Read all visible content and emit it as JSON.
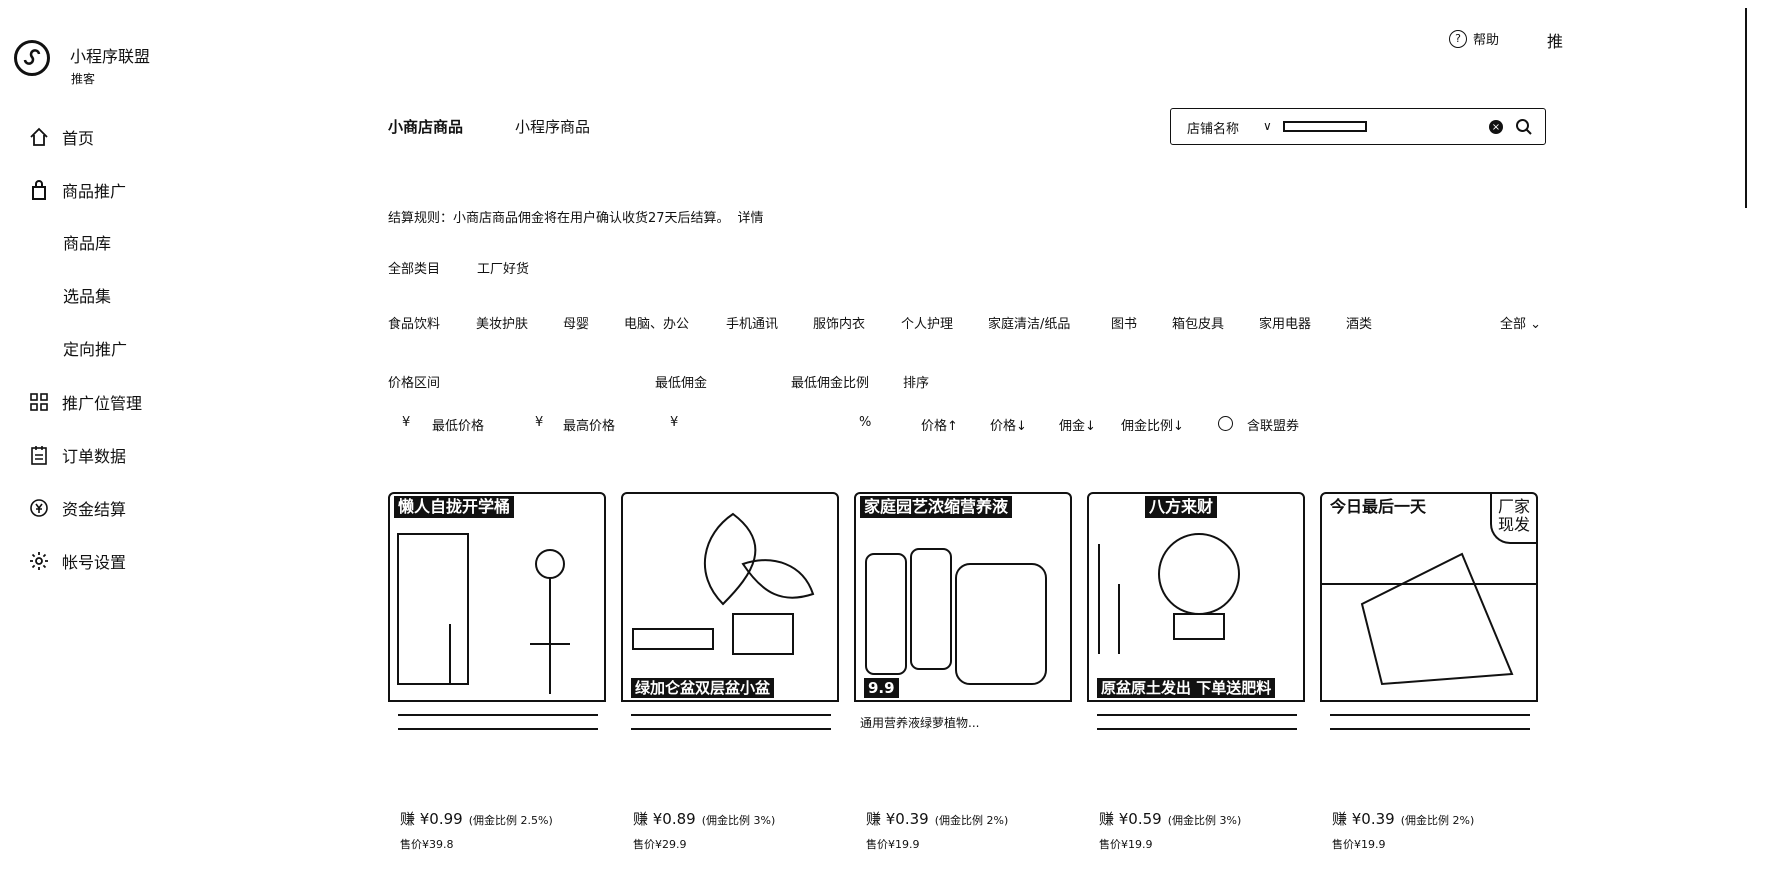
{
  "brand": {
    "title": "小程序联盟",
    "subtitle": "推客"
  },
  "header": {
    "help_label": "帮助",
    "push_label": "推"
  },
  "sidebar": {
    "items": [
      {
        "label": "首页",
        "icon": "home-icon"
      },
      {
        "label": "商品推广",
        "icon": "bag-icon"
      },
      {
        "label": "商品库",
        "sub": true
      },
      {
        "label": "选品集",
        "sub": true
      },
      {
        "label": "定向推广",
        "sub": true
      },
      {
        "label": "推广位管理",
        "icon": "grid-icon"
      },
      {
        "label": "订单数据",
        "icon": "clipboard-icon"
      },
      {
        "label": "资金结算",
        "icon": "yuan-icon"
      },
      {
        "label": "帐号设置",
        "icon": "gear-icon"
      }
    ]
  },
  "tabs": [
    {
      "label": "小商店商品",
      "active": true
    },
    {
      "label": "小程序商品",
      "active": false
    }
  ],
  "search": {
    "select_label": "店铺名称",
    "value": ""
  },
  "rule": {
    "text": "结算规则：小商店商品佣金将在用户确认收货27天后结算。",
    "link": "详情"
  },
  "category_types": [
    "全部类目",
    "工厂好货"
  ],
  "categories": [
    "食品饮料",
    "美妆护肤",
    "母婴",
    "电脑、办公",
    "手机通讯",
    "服饰内衣",
    "个人护理",
    "家庭清洁/纸品",
    "图书",
    "箱包皮具",
    "家用电器",
    "酒类"
  ],
  "categories_all": "全部",
  "filters": {
    "price_range_label": "价格区间",
    "min_commission_label": "最低佣金",
    "min_ratio_label": "最低佣金比例",
    "sort_label": "排序",
    "currency": "¥",
    "min_price_placeholder": "最低价格",
    "max_price_placeholder": "最高价格",
    "percent": "%",
    "sort_options": [
      "价格↑",
      "价格↓",
      "佣金↓",
      "佣金比例↓"
    ],
    "coupon_label": "含联盟券"
  },
  "products": [
    {
      "banner": "懒人自拢开学桶",
      "bottom": "",
      "title": "",
      "earn": "赚 ¥0.99",
      "ratio": "(佣金比例 2.5%)",
      "price": "售价¥39.8"
    },
    {
      "banner": "",
      "bottom": "绿加仑盆双层盆小盆",
      "title": "",
      "earn": "赚 ¥0.89",
      "ratio": "(佣金比例 3%)",
      "price": "售价¥29.9"
    },
    {
      "banner": "家庭园艺浓缩营养液",
      "bottom": "9.9",
      "title": "通用营养液绿萝植物...",
      "earn": "赚 ¥0.39",
      "ratio": "(佣金比例 2%)",
      "price": "售价¥19.9"
    },
    {
      "banner": "八方来财",
      "bottom": "原盆原土发出 下单送肥料",
      "title": "",
      "earn": "赚 ¥0.59",
      "ratio": "(佣金比例 3%)",
      "price": "售价¥19.9"
    },
    {
      "banner": "今日最后一天",
      "bottom": "",
      "title": "",
      "earn": "赚 ¥0.39",
      "ratio": "(佣金比例 2%)",
      "price": "售价¥19.9",
      "tag": "厂家现发"
    }
  ]
}
